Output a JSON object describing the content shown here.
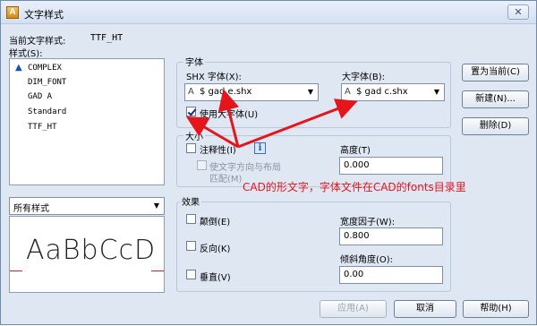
{
  "window": {
    "title": "文字样式",
    "close_glyph": "✕"
  },
  "current_style": {
    "label": "当前文字样式:",
    "value": "TTF_HT"
  },
  "styles": {
    "label": "样式(S):",
    "items": [
      "COMPLEX",
      "DIM_FONT",
      "GAD A",
      "Standard",
      "TTF_HT"
    ],
    "annotative_icon": "annotative-triangle-icon",
    "filter_value": "所有样式"
  },
  "preview": {
    "sample": "AaBbCcD"
  },
  "font": {
    "group_title": "字体",
    "shx_label": "SHX 字体(X):",
    "shx_value": "$ gad e.shx",
    "big_label": "大字体(B):",
    "big_value": "$ gad c.shx",
    "use_big_font_label": "使用大字体(U)",
    "use_big_font_checked": true,
    "font_icon": "shx-font-icon"
  },
  "size": {
    "group_title": "大小",
    "annotative_label": "注释性(I)",
    "annotative_checked": false,
    "orientation_label_line1": "使文字方向与布局",
    "orientation_label_line2": "匹配(M)",
    "height_label": "高度(T)",
    "height_value": "0.000",
    "info_glyph": "i"
  },
  "effects": {
    "group_title": "效果",
    "upside_down": "颠倒(E)",
    "backwards": "反向(K)",
    "vertical": "垂直(V)",
    "width_factor_label": "宽度因子(W):",
    "width_factor_value": "0.800",
    "oblique_label": "倾斜角度(O):",
    "oblique_value": "0.00"
  },
  "buttons": {
    "set_current": "置为当前(C)",
    "new": "新建(N)...",
    "delete": "删除(D)",
    "apply": "应用(A)",
    "cancel": "取消",
    "help": "帮助(H)"
  },
  "annotation": {
    "text": "CAD的形文字，字体文件在CAD的fonts目录里",
    "color": "#e4161c"
  },
  "colors": {
    "dialog_bg": "#dfe7f3",
    "preview_baseline": "#d32222"
  }
}
